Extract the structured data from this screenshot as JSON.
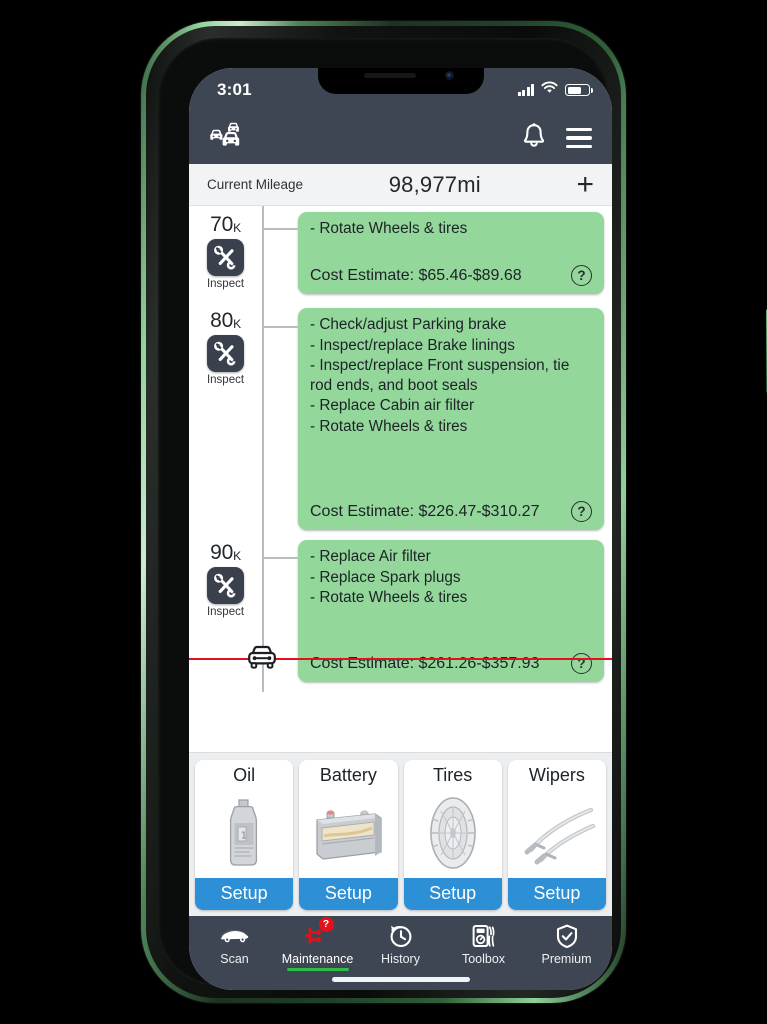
{
  "status_bar": {
    "time": "3:01",
    "icons": [
      "signal-icon",
      "wifi-icon",
      "battery-icon"
    ],
    "battery_level": "58%"
  },
  "app_bar": {
    "garage_icon": "cars-icon",
    "bell_icon": "bell-icon",
    "menu_icon": "hamburger-menu-icon"
  },
  "mileage_bar": {
    "label": "Current Mileage",
    "value": "98,977mi",
    "add_label": "+"
  },
  "timeline": {
    "milestones": [
      {
        "mileage": "70",
        "unit": "K",
        "icon_label": "Inspect",
        "tasks": [
          "- Rotate Wheels & tires"
        ],
        "cost": "Cost Estimate: $65.46-$89.68",
        "help": "?"
      },
      {
        "mileage": "80",
        "unit": "K",
        "icon_label": "Inspect",
        "tasks": [
          "- Check/adjust Parking brake",
          "- Inspect/replace Brake linings",
          "- Inspect/replace Front suspension, tie rod ends, and boot seals",
          "- Replace Cabin air filter",
          "- Rotate Wheels & tires"
        ],
        "cost": "Cost Estimate: $226.47-$310.27",
        "help": "?"
      },
      {
        "mileage": "90",
        "unit": "K",
        "icon_label": "Inspect",
        "tasks": [
          "- Replace Air filter",
          "- Replace Spark plugs",
          "- Rotate Wheels & tires"
        ],
        "cost": "Cost Estimate: $261.26-$357.93",
        "help": "?"
      }
    ],
    "current_marker_icon": "car-icon",
    "current_marker_color": "#e3121a",
    "card_color": "#93d79b"
  },
  "quick_cards": [
    {
      "title": "Oil",
      "art": "oil-bottle-image",
      "button": "Setup"
    },
    {
      "title": "Battery",
      "art": "car-battery-image",
      "button": "Setup"
    },
    {
      "title": "Tires",
      "art": "tire-image",
      "button": "Setup"
    },
    {
      "title": "Wipers",
      "art": "wiper-blades-image",
      "button": "Setup"
    }
  ],
  "tab_bar": {
    "tabs": [
      {
        "label": "Scan",
        "icon": "car-icon",
        "active": false,
        "badge": ""
      },
      {
        "label": "Maintenance",
        "icon": "wrench-icon",
        "active": true,
        "badge": "?"
      },
      {
        "label": "History",
        "icon": "clock-history-icon",
        "active": false,
        "badge": ""
      },
      {
        "label": "Toolbox",
        "icon": "toolbox-meter-icon",
        "active": false,
        "badge": ""
      },
      {
        "label": "Premium",
        "icon": "shield-check-icon",
        "active": false,
        "badge": ""
      }
    ],
    "active_color": "#2fbe4a",
    "badge_color": "#e3121a"
  },
  "theme": {
    "header_bg": "#3f4653",
    "accent_blue": "#2d8fd5",
    "card_green": "#93d79b",
    "phone_frame": "#6fae79"
  }
}
